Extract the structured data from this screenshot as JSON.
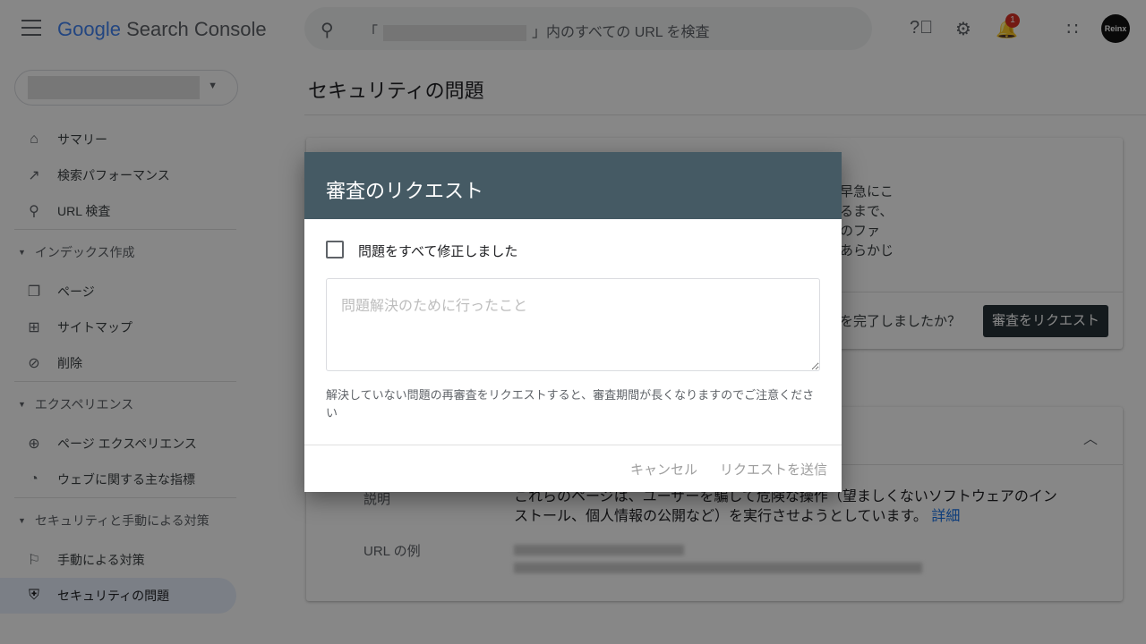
{
  "header": {
    "logo_google": "Google",
    "logo_product": "Search Console",
    "search_prefix": "「",
    "search_suffix": "」内のすべての URL を検査",
    "notification_count": "1",
    "avatar_text": "Reinx"
  },
  "page_title": "セキュリティの問題",
  "sidebar": {
    "top": [
      {
        "label": "サマリー",
        "icon": "home"
      },
      {
        "label": "検索パフォーマンス",
        "icon": "trending-up"
      },
      {
        "label": "URL 検査",
        "icon": "search"
      }
    ],
    "sections": [
      {
        "title": "インデックス作成",
        "items": [
          {
            "label": "ページ",
            "icon": "copy"
          },
          {
            "label": "サイトマップ",
            "icon": "sitemap"
          },
          {
            "label": "削除",
            "icon": "visibility-off"
          }
        ]
      },
      {
        "title": "エクスペリエンス",
        "items": [
          {
            "label": "ページ エクスペリエンス",
            "icon": "plus-circle"
          },
          {
            "label": "ウェブに関する主な指標",
            "icon": "speed"
          }
        ]
      },
      {
        "title": "セキュリティと手動による対策",
        "items": [
          {
            "label": "手動による対策",
            "icon": "flag"
          },
          {
            "label": "セキュリティの問題",
            "icon": "shield",
            "active": true
          }
        ]
      }
    ]
  },
  "card1": {
    "text_lines": [
      "早急にこ",
      "るまで、",
      "のファ",
      "あらかじ"
    ],
    "question": "を完了しましたか？",
    "button": "審査をリクエスト"
  },
  "card2": {
    "desc_label": "説明",
    "desc_text": "これらのページは、ユーザーを騙して危険な操作（望ましくないソフトウェアのインストール、個人情報の公開など）を実行させようとしています。",
    "desc_link": "詳細",
    "url_label": "URL の例"
  },
  "dialog": {
    "title": "審査のリクエスト",
    "checkbox_label": "問題をすべて修正しました",
    "checked": false,
    "textarea_placeholder": "問題解決のために行ったこと",
    "textarea_value": "",
    "note": "解決していない問題の再審査をリクエストすると、審査期間が長くなりますのでご注意ください",
    "cancel": "キャンセル",
    "submit": "リクエストを送信"
  },
  "colors": {
    "dialog_header": "#455a64",
    "primary_button": "#263238",
    "link": "#1a73e8",
    "badge": "#d93025"
  }
}
